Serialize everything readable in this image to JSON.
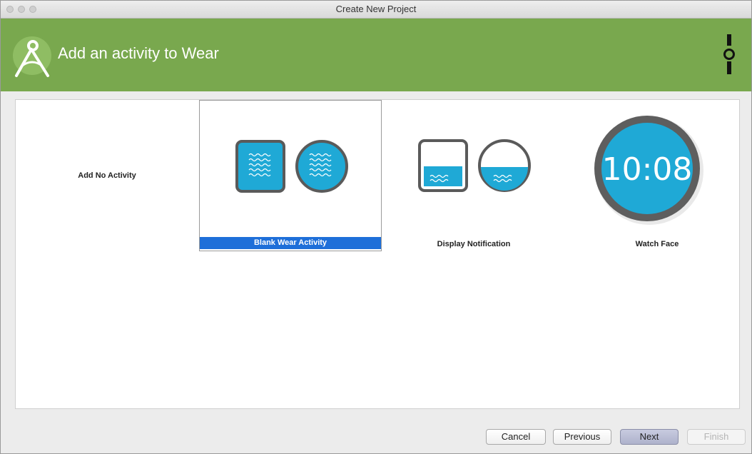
{
  "window": {
    "title": "Create New Project"
  },
  "header": {
    "title": "Add an activity to Wear"
  },
  "activities": [
    {
      "label": "Add No Activity",
      "selected": false
    },
    {
      "label": "Blank Wear Activity",
      "selected": true
    },
    {
      "label": "Display Notification",
      "selected": false
    },
    {
      "label": "Watch Face",
      "selected": false,
      "time": "10:08"
    }
  ],
  "buttons": {
    "cancel": "Cancel",
    "previous": "Previous",
    "next": "Next",
    "finish": "Finish"
  },
  "colors": {
    "header_bg": "#79a84e",
    "selection": "#1e6fd9",
    "device_screen": "#1fa9d6",
    "device_bezel": "#5a5a5a"
  }
}
